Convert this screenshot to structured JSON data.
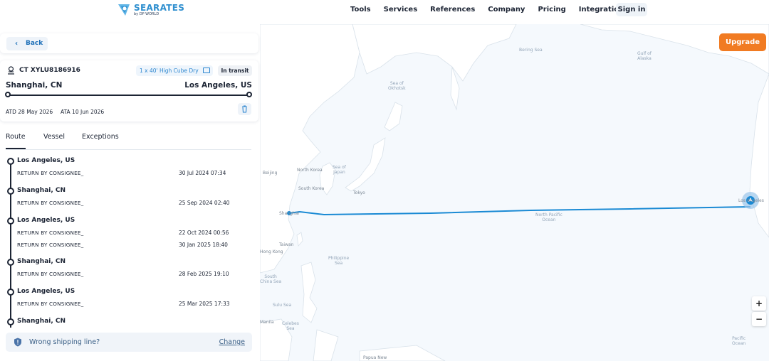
{
  "header": {
    "logo": {
      "title": "SEARATES",
      "subtitle": "by DP WORLD"
    },
    "nav": [
      "Tools",
      "Services",
      "References",
      "Company",
      "Pricing",
      "Integrations"
    ],
    "sign_in": "Sign in"
  },
  "upgrade_label": "Upgrade",
  "panel": {
    "back_label": "Back",
    "shipment": {
      "number": "CT XYLU8186916",
      "container": "1 x 40' High Cube Dry",
      "status": "In transit",
      "origin": "Shanghai, CN",
      "destination": "Los Angeles, US",
      "atd": "ATD 28 May 2026",
      "ata": "ATA 10 Jun 2026"
    },
    "tabs": [
      "Route",
      "Vessel",
      "Exceptions"
    ],
    "active_tab": "Route",
    "events": [
      {
        "location": "Los Angeles, US",
        "items": [
          {
            "label": "RETURN BY CONSIGNEE_",
            "date": "30 Jul 2024 07:34"
          }
        ]
      },
      {
        "location": "Shanghai, CN",
        "items": [
          {
            "label": "RETURN BY CONSIGNEE_",
            "date": "25 Sep 2024 02:40"
          }
        ]
      },
      {
        "location": "Los Angeles, US",
        "items": [
          {
            "label": "RETURN BY CONSIGNEE_",
            "date": "22 Oct 2024 00:56"
          },
          {
            "label": "RETURN BY CONSIGNEE_",
            "date": "30 Jan 2025 18:40"
          }
        ]
      },
      {
        "location": "Shanghai, CN",
        "items": [
          {
            "label": "RETURN BY CONSIGNEE_",
            "date": "28 Feb 2025 19:10"
          }
        ]
      },
      {
        "location": "Los Angeles, US",
        "items": [
          {
            "label": "RETURN BY CONSIGNEE_",
            "date": "25 Mar 2025 17:33"
          }
        ]
      },
      {
        "location": "Shanghai, CN",
        "items": []
      }
    ],
    "notice": {
      "text": "Wrong shipping line?",
      "link": "Change"
    }
  },
  "map": {
    "labels": {
      "bering_sea": "Bering Sea",
      "gulf_of_alaska": "Gulf of\nAlaska",
      "sea_of_okhotsk": "Sea of\nOkhotsk",
      "beijing": "Beijing",
      "north_korea": "North Korea",
      "sea_of_japan": "Sea of\nJapan",
      "south_korea": "South Korea",
      "tokyo": "Tokyo",
      "shanghai": "Shanghai",
      "north_pacific_ocean": "North Pacific\nOcean",
      "los_angeles": "Los Angeles",
      "hong_kong": "Hong Kong",
      "taiwan": "Taiwan",
      "philippine_sea": "Philippine\nSea",
      "south_china_sea": "South\nChina Sea",
      "sulu_sea": "Sulu Sea",
      "celebes_sea": "Celebes\nSea",
      "papua_new": "Papua New",
      "pacific_ocean": "Pacific\nOcean",
      "manila": "Manila"
    },
    "route_color": "#1a8ad4",
    "zoom_in": "+",
    "zoom_out": "−"
  },
  "colors": {
    "accent": "#2c86cf",
    "upgrade": "#f17b22",
    "text": "#1c2434"
  }
}
